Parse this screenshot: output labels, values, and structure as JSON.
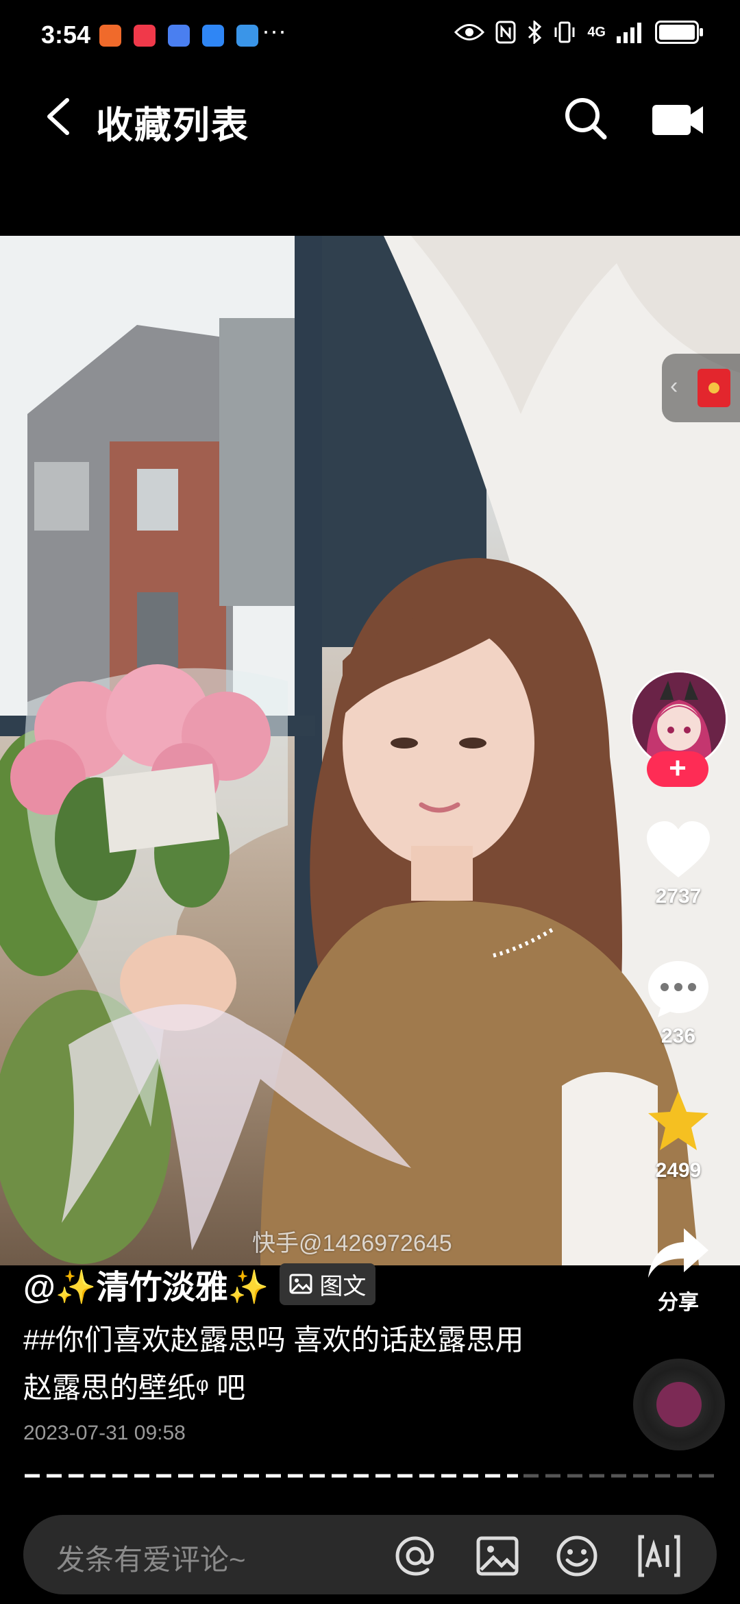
{
  "status_bar": {
    "time": "3:54",
    "more": "···",
    "signal_label": "4G",
    "battery_level": 0.9
  },
  "header": {
    "title": "收藏列表",
    "back_icon": "chevron-left-icon",
    "search_icon": "search-icon",
    "camera_icon": "camera-icon"
  },
  "post": {
    "watermark": "快手@1426972645",
    "author": "@✨清竹淡雅✨",
    "tag_label": "图文",
    "description": "##你们喜欢赵露思吗 喜欢的话赵露思用 赵露思的壁纸ᵠ 吧",
    "date": "2023-07-31 09:58"
  },
  "actions": {
    "like_count": "2737",
    "comment_count": "236",
    "favorite_count": "2499",
    "share_label": "分享"
  },
  "comment": {
    "placeholder": "发条有爱评论~"
  },
  "colors": {
    "accent": "#fe2c55",
    "favorite": "#f5c021"
  }
}
